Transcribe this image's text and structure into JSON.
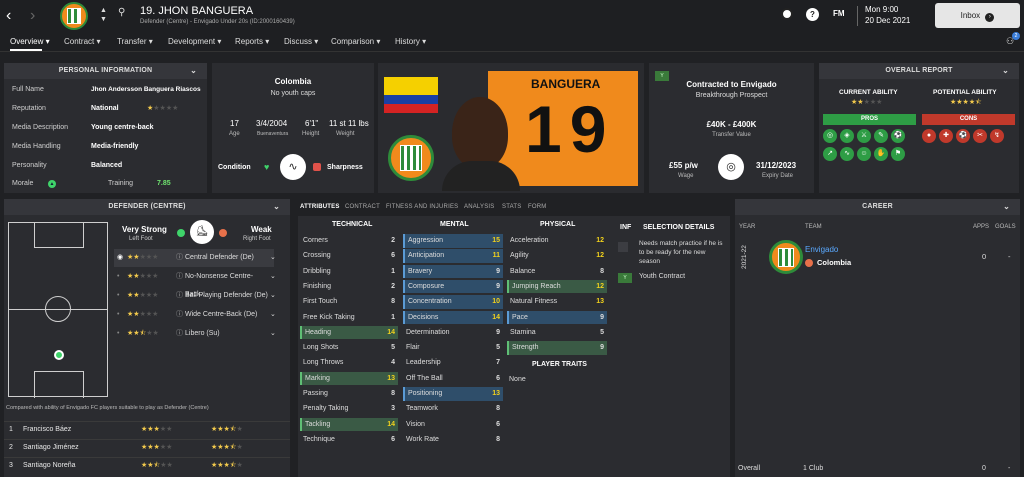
{
  "topbar": {
    "title": "19. JHON BANGUERA",
    "subtitle": "Defender (Centre) - Envigado Under 20s (ID:2000160439)",
    "date_line1": "Mon 9:00",
    "date_line2": "20 Dec 2021",
    "inbox_label": "Inbox",
    "fm_label": "FM",
    "help_label": "?",
    "notif_count": "2"
  },
  "nav": [
    "Overview",
    "Contract",
    "Transfer",
    "Development",
    "Reports",
    "Discuss",
    "Comparison",
    "History"
  ],
  "personal": {
    "header": "PERSONAL INFORMATION",
    "rows": [
      {
        "label": "Full Name",
        "value": "Jhon Andersson Banguera Riascos"
      },
      {
        "label": "Reputation",
        "value": "National"
      },
      {
        "label": "Media Description",
        "value": "Young centre-back"
      },
      {
        "label": "Media Handling",
        "value": "Media-friendly"
      },
      {
        "label": "Personality",
        "value": "Balanced"
      }
    ],
    "morale_label": "Morale",
    "training_label": "Training",
    "training_value": "7.85"
  },
  "bio": {
    "nation": "Colombia",
    "youth_caps": "No youth caps",
    "age": "17",
    "age_label": "Age",
    "dob": "3/4/2004",
    "birthplace": "Buenaventura",
    "height": "6'1\"",
    "height_label": "Height",
    "weight": "11 st 11 lbs",
    "weight_label": "Weight",
    "condition_label": "Condition",
    "sharpness_label": "Sharpness"
  },
  "shirt": {
    "name": "BANGUERA",
    "number": "19"
  },
  "contract": {
    "youth_tag": "Y",
    "title": "Contracted to Envigado",
    "status": "Breakthrough Prospect",
    "value": "£40K - £400K",
    "value_label": "Transfer Value",
    "wage": "£55 p/w",
    "wage_label": "Wage",
    "expiry": "31/12/2023",
    "expiry_label": "Expiry Date"
  },
  "report": {
    "header": "OVERALL REPORT",
    "ca_label": "CURRENT ABILITY",
    "pa_label": "POTENTIAL ABILITY",
    "ca_stars": 2,
    "pa_stars": 4.5,
    "pros_label": "PROS",
    "cons_label": "CONS"
  },
  "position": {
    "header": "DEFENDER (CENTRE)",
    "strong_foot": "Very Strong",
    "strong_foot_label": "Left Foot",
    "weak_foot": "Weak",
    "weak_foot_label": "Right Foot",
    "roles": [
      {
        "name": "Central Defender (De)",
        "stars": 2
      },
      {
        "name": "No-Nonsense Centre-Back...",
        "stars": 2
      },
      {
        "name": "Ball Playing Defender (De)",
        "stars": 2
      },
      {
        "name": "Wide Centre-Back (De)",
        "stars": 2
      },
      {
        "name": "Libero (Su)",
        "stars": 2.5
      }
    ],
    "compare_text": "Compared with ability of Envigado FC players suitable to play as Defender (Centre)",
    "comparisons": [
      {
        "rank": "1",
        "name": "Francisco Báez",
        "ca": 3,
        "pa": 3.5
      },
      {
        "rank": "2",
        "name": "Santiago Jiménez",
        "ca": 3,
        "pa": 3.5
      },
      {
        "rank": "3",
        "name": "Santiago Noreña",
        "ca": 2.5,
        "pa": 3.5
      }
    ]
  },
  "tabs": [
    "ATTRIBUTES",
    "CONTRACT",
    "FITNESS AND INJURIES",
    "ANALYSIS",
    "STATS",
    "FORM"
  ],
  "attributes": {
    "technical_label": "TECHNICAL",
    "mental_label": "MENTAL",
    "physical_label": "PHYSICAL",
    "technical": [
      {
        "name": "Corners",
        "value": "2"
      },
      {
        "name": "Crossing",
        "value": "6"
      },
      {
        "name": "Dribbling",
        "value": "1"
      },
      {
        "name": "Finishing",
        "value": "2"
      },
      {
        "name": "First Touch",
        "value": "8"
      },
      {
        "name": "Free Kick Taking",
        "value": "1"
      },
      {
        "name": "Heading",
        "value": "14"
      },
      {
        "name": "Long Shots",
        "value": "5"
      },
      {
        "name": "Long Throws",
        "value": "4"
      },
      {
        "name": "Marking",
        "value": "13"
      },
      {
        "name": "Passing",
        "value": "8"
      },
      {
        "name": "Penalty Taking",
        "value": "3"
      },
      {
        "name": "Tackling",
        "value": "14"
      },
      {
        "name": "Technique",
        "value": "6"
      }
    ],
    "mental": [
      {
        "name": "Aggression",
        "value": "15"
      },
      {
        "name": "Anticipation",
        "value": "11"
      },
      {
        "name": "Bravery",
        "value": "9"
      },
      {
        "name": "Composure",
        "value": "9"
      },
      {
        "name": "Concentration",
        "value": "10"
      },
      {
        "name": "Decisions",
        "value": "14"
      },
      {
        "name": "Determination",
        "value": "9"
      },
      {
        "name": "Flair",
        "value": "5"
      },
      {
        "name": "Leadership",
        "value": "7"
      },
      {
        "name": "Off The Ball",
        "value": "6"
      },
      {
        "name": "Positioning",
        "value": "13"
      },
      {
        "name": "Teamwork",
        "value": "8"
      },
      {
        "name": "Vision",
        "value": "6"
      },
      {
        "name": "Work Rate",
        "value": "8"
      }
    ],
    "physical": [
      {
        "name": "Acceleration",
        "value": "12"
      },
      {
        "name": "Agility",
        "value": "12"
      },
      {
        "name": "Balance",
        "value": "8"
      },
      {
        "name": "Jumping Reach",
        "value": "12"
      },
      {
        "name": "Natural Fitness",
        "value": "13"
      },
      {
        "name": "Pace",
        "value": "9"
      },
      {
        "name": "Stamina",
        "value": "5"
      },
      {
        "name": "Strength",
        "value": "9"
      }
    ],
    "traits_label": "PLAYER TRAITS",
    "traits_value": "None"
  },
  "selection": {
    "inf_label": "INF",
    "header": "SELECTION DETAILS",
    "text": "Needs match practice if he is to be ready for the new season",
    "youth_tag": "Y",
    "youth_contract": "Youth Contract"
  },
  "career": {
    "header": "CAREER",
    "col_year": "YEAR",
    "col_team": "TEAM",
    "col_apps": "APPS",
    "col_goals": "GOALS",
    "season": "2021-22",
    "team": "Envigado",
    "country": "Colombia",
    "apps": "0",
    "goals": "-",
    "overall_label": "Overall",
    "overall_clubs": "1 Club",
    "overall_apps": "0",
    "overall_goals": "-"
  }
}
